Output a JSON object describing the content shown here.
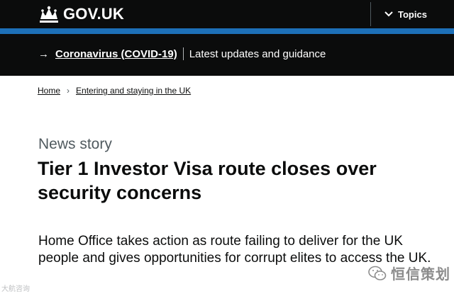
{
  "header": {
    "logo_text": "GOV.UK",
    "crown_icon": "crown-icon",
    "topics_label": "Topics",
    "topics_icon": "chevron-down-icon"
  },
  "colors": {
    "header_bg": "#0b0c0c",
    "accent_bar": "#1d70b8",
    "text": "#0b0c0c",
    "secondary_text": "#505a5f"
  },
  "banner": {
    "arrow": "→",
    "link_text": "Coronavirus (COVID-19)",
    "text": "Latest updates and guidance"
  },
  "breadcrumb": {
    "items": [
      "Home",
      "Entering and staying in the UK"
    ],
    "separator": "›"
  },
  "article": {
    "caption": "News story",
    "title": "Tier 1 Investor Visa route closes over security concerns",
    "lead": "Home Office takes action as route failing to deliver for the UK people and gives opportunities for corrupt elites to access the UK."
  },
  "watermarks": {
    "left": "大航咨询",
    "right": "恒信策划"
  }
}
